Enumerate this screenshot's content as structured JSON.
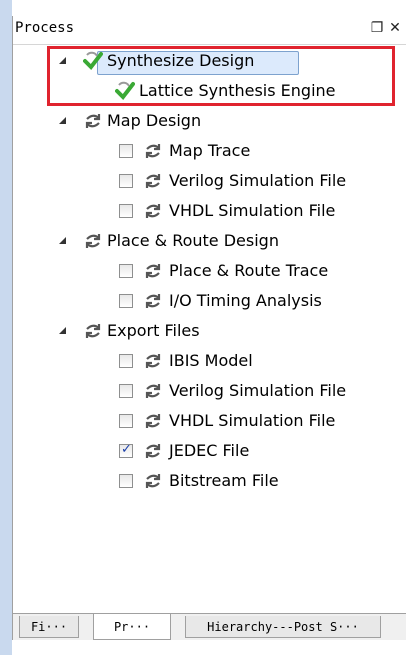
{
  "panel": {
    "title": "Process",
    "restore_icon": "restore-icon",
    "close_icon": "close-icon"
  },
  "tree": {
    "synthesize": {
      "label": "Synthesize Design",
      "icon": "green-check-icon",
      "selected": true
    },
    "lattice_engine": {
      "label": "Lattice Synthesis Engine",
      "icon": "green-check-icon"
    },
    "map_design": {
      "label": "Map Design",
      "icon": "refresh-arrows-icon"
    },
    "map_trace": {
      "label": "Map Trace",
      "checked": false
    },
    "map_verilog": {
      "label": "Verilog Simulation File",
      "checked": false
    },
    "map_vhdl": {
      "label": "VHDL Simulation File",
      "checked": false
    },
    "par_design": {
      "label": "Place & Route Design",
      "icon": "refresh-arrows-icon"
    },
    "par_trace": {
      "label": "Place & Route Trace",
      "checked": false
    },
    "io_timing": {
      "label": "I/O Timing Analysis",
      "checked": false
    },
    "export_files": {
      "label": "Export Files",
      "icon": "refresh-arrows-icon"
    },
    "ibis": {
      "label": "IBIS Model",
      "checked": false
    },
    "exp_verilog": {
      "label": "Verilog Simulation File",
      "checked": false
    },
    "exp_vhdl": {
      "label": "VHDL Simulation File",
      "checked": false
    },
    "jedec": {
      "label": "JEDEC File",
      "checked": true,
      "checkmark": "✓"
    },
    "bitstream": {
      "label": "Bitstream File",
      "checked": false
    }
  },
  "tabs": [
    {
      "label": "Fi···"
    },
    {
      "label": "Pr···",
      "active": true
    },
    {
      "label": "Hierarchy---Post S···"
    }
  ],
  "colors": {
    "highlight_red": "#e0232e",
    "selection": "#dceafc",
    "check_green": "#3aa935",
    "arrows_gray": "#555555"
  }
}
